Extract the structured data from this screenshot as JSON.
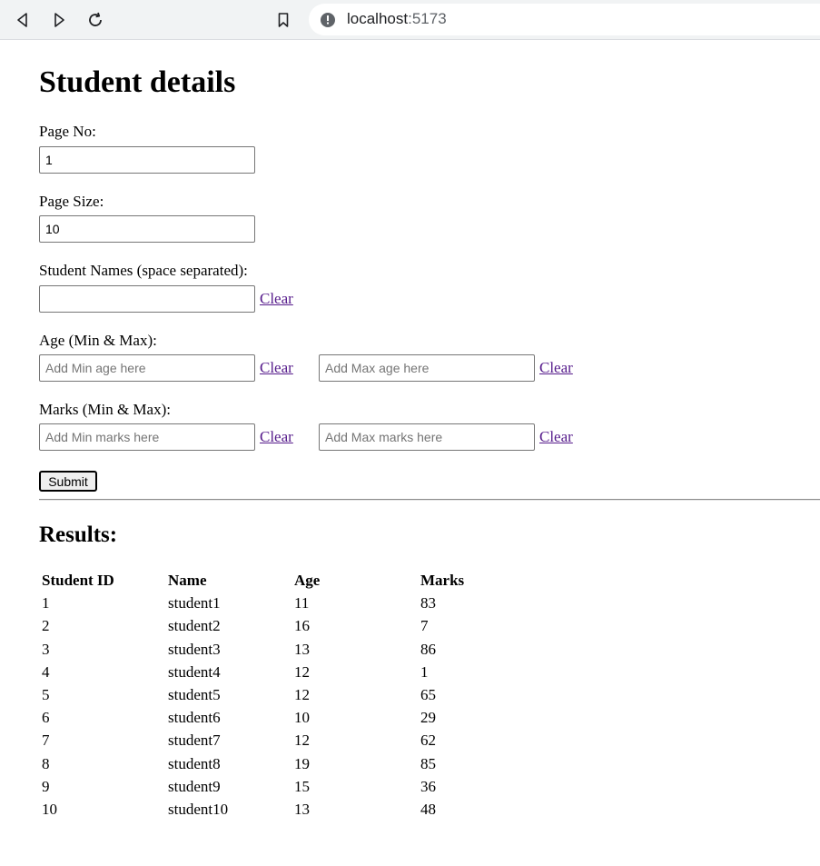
{
  "browser": {
    "url_host": "localhost",
    "url_port": ":5173"
  },
  "page": {
    "title": "Student details",
    "page_no": {
      "label": "Page No:",
      "value": "1"
    },
    "page_size": {
      "label": "Page Size:",
      "value": "10"
    },
    "student_names": {
      "label": "Student Names (space separated):",
      "value": "",
      "clear_label": "Clear"
    },
    "age": {
      "label": "Age (Min & Max):",
      "min_placeholder": "Add Min age here",
      "max_placeholder": "Add Max age here",
      "clear_label": "Clear"
    },
    "marks": {
      "label": "Marks (Min & Max):",
      "min_placeholder": "Add Min marks here",
      "max_placeholder": "Add Max marks here",
      "clear_label": "Clear"
    },
    "submit_label": "Submit",
    "results_heading": "Results:"
  },
  "results": {
    "headers": [
      "Student ID",
      "Name",
      "Age",
      "Marks"
    ],
    "rows": [
      [
        "1",
        "student1",
        "11",
        "83"
      ],
      [
        "2",
        "student2",
        "16",
        "7"
      ],
      [
        "3",
        "student3",
        "13",
        "86"
      ],
      [
        "4",
        "student4",
        "12",
        "1"
      ],
      [
        "5",
        "student5",
        "12",
        "65"
      ],
      [
        "6",
        "student6",
        "10",
        "29"
      ],
      [
        "7",
        "student7",
        "12",
        "62"
      ],
      [
        "8",
        "student8",
        "19",
        "85"
      ],
      [
        "9",
        "student9",
        "15",
        "36"
      ],
      [
        "10",
        "student10",
        "13",
        "48"
      ]
    ]
  },
  "colors": {
    "link_visited": "#551a8b",
    "toolbar_bg": "#f1f3f4"
  }
}
